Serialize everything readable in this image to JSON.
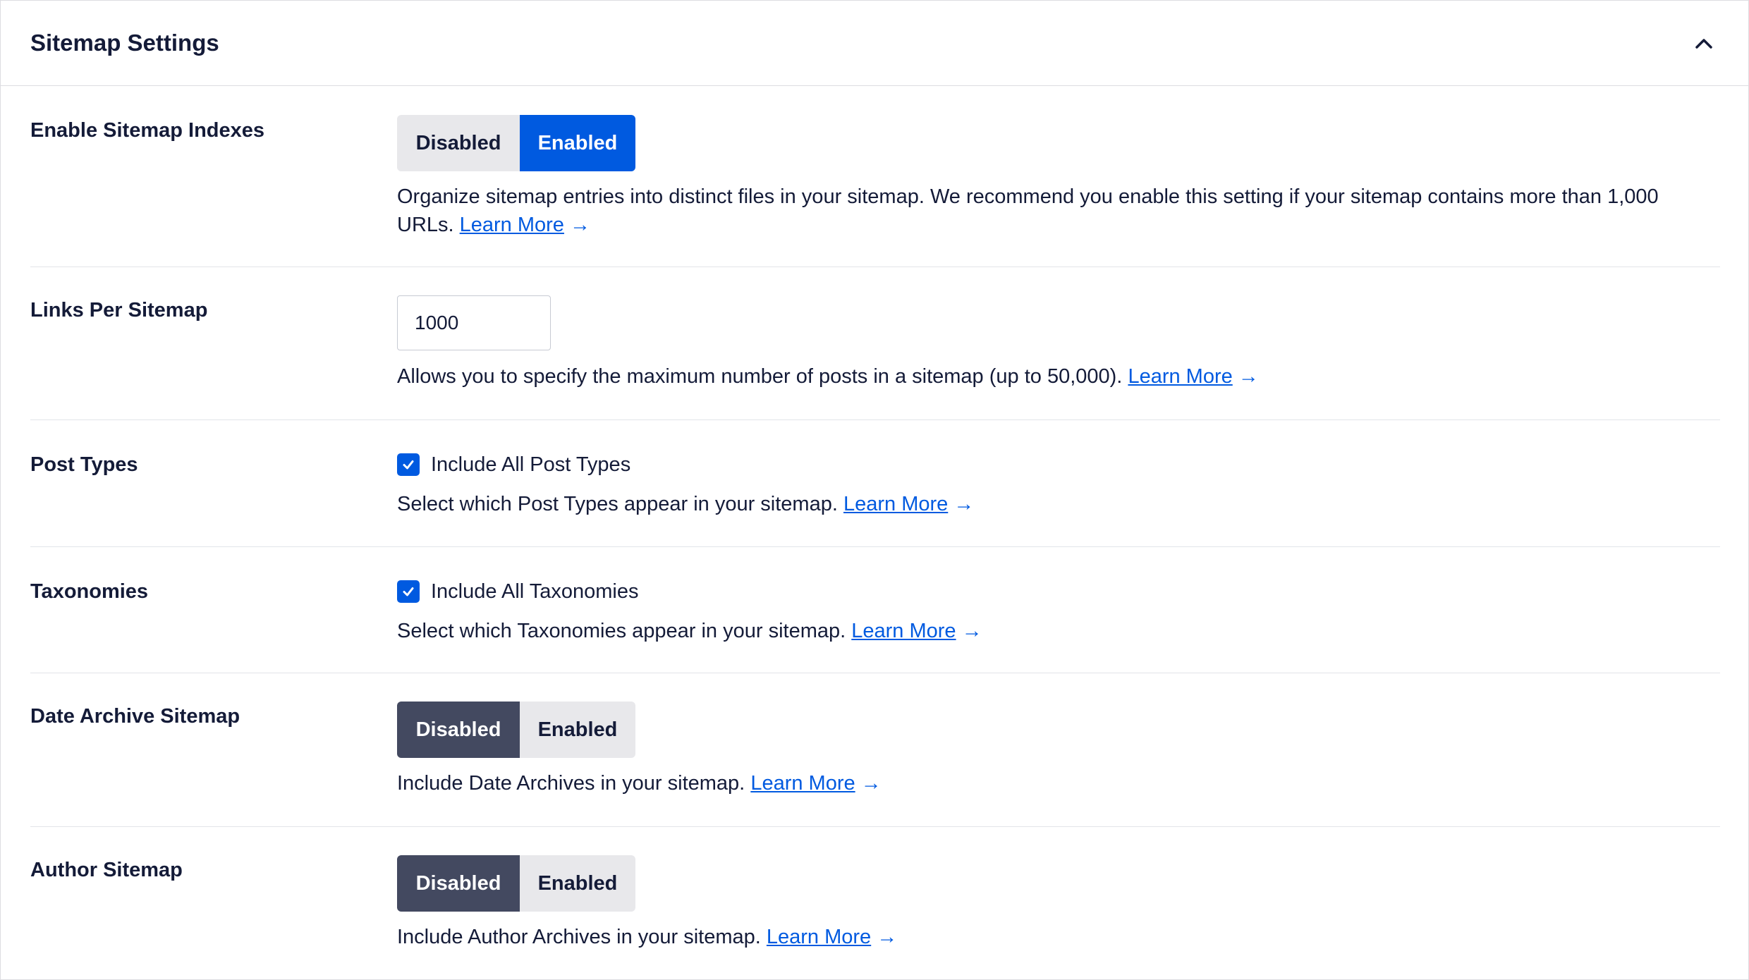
{
  "panel": {
    "title": "Sitemap Settings",
    "collapse_icon": "chevron-up-icon"
  },
  "rows": {
    "sitemap_indexes": {
      "label": "Enable Sitemap Indexes",
      "options": [
        "Disabled",
        "Enabled"
      ],
      "selected": "Enabled",
      "description": "Organize sitemap entries into distinct files in your sitemap. We recommend you enable this setting if your sitemap contains more than 1,000 URLs.",
      "link": "Learn More",
      "arrow": "→"
    },
    "links_per_sitemap": {
      "label": "Links Per Sitemap",
      "value": "1000",
      "description": "Allows you to specify the maximum number of posts in a sitemap (up to 50,000).",
      "link": "Learn More",
      "arrow": "→"
    },
    "post_types": {
      "label": "Post Types",
      "checkbox_label": "Include All Post Types",
      "checked": true,
      "description": "Select which Post Types appear in your sitemap.",
      "link": "Learn More",
      "arrow": "→"
    },
    "taxonomies": {
      "label": "Taxonomies",
      "checkbox_label": "Include All Taxonomies",
      "checked": true,
      "description": "Select which Taxonomies appear in your sitemap.",
      "link": "Learn More",
      "arrow": "→"
    },
    "date_archive": {
      "label": "Date Archive Sitemap",
      "options": [
        "Disabled",
        "Enabled"
      ],
      "selected": "Disabled",
      "description": "Include Date Archives in your sitemap.",
      "link": "Learn More",
      "arrow": "→"
    },
    "author_sitemap": {
      "label": "Author Sitemap",
      "options": [
        "Disabled",
        "Enabled"
      ],
      "selected": "Disabled",
      "description": "Include Author Archives in your sitemap.",
      "link": "Learn More",
      "arrow": "→"
    }
  },
  "colors": {
    "primary": "#005ae0",
    "dark_active": "#434960",
    "inactive": "#e8e8eb",
    "text": "#141b38"
  }
}
